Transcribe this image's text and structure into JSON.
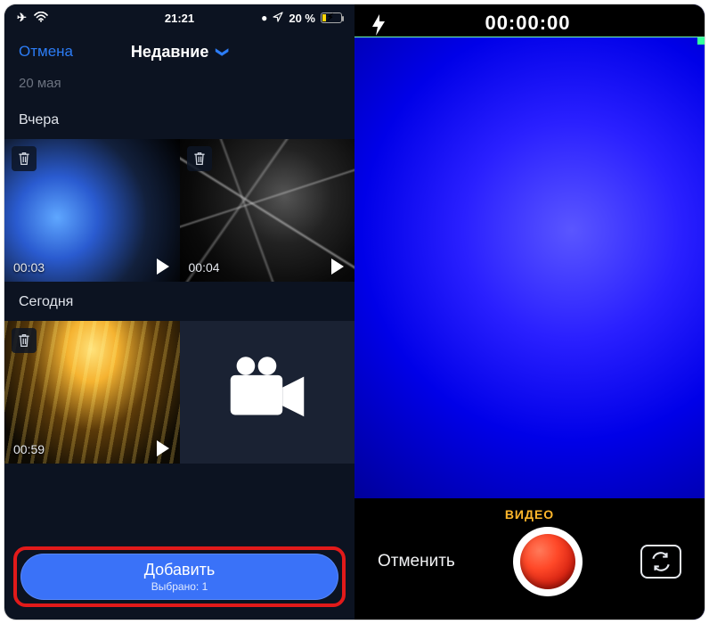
{
  "status": {
    "time": "21:21",
    "battery_pct": "20 %"
  },
  "picker": {
    "cancel": "Отмена",
    "title": "Недавние",
    "prev_section": "20 мая",
    "sections": [
      {
        "title": "Вчера",
        "items": [
          {
            "duration": "00:03"
          },
          {
            "duration": "00:04"
          }
        ]
      },
      {
        "title": "Сегодня",
        "items": [
          {
            "duration": "00:59"
          },
          {
            "duration": ""
          }
        ]
      }
    ],
    "add": {
      "label": "Добавить",
      "sub": "Выбрано: 1"
    }
  },
  "camera": {
    "timer": "00:00:00",
    "mode": "ВИДЕО",
    "cancel": "Отменить"
  }
}
